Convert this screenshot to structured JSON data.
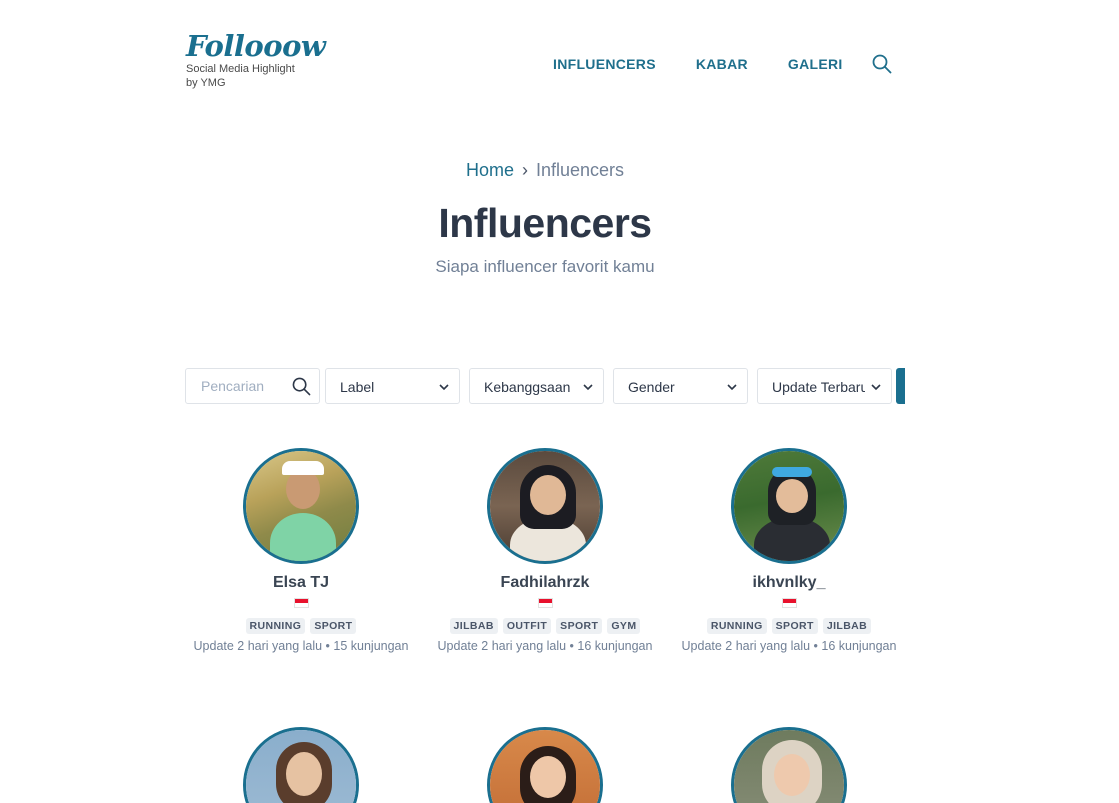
{
  "brand": {
    "name": "Follooow",
    "tagline_line1": "Social Media Highlight",
    "tagline_line2": "by YMG"
  },
  "nav": {
    "items": [
      "INFLUENCERS",
      "KABAR",
      "GALERI"
    ],
    "search_icon": "search-icon"
  },
  "breadcrumb": {
    "home": "Home",
    "separator": "›",
    "current": "Influencers"
  },
  "hero": {
    "title": "Influencers",
    "subtitle": "Siapa influencer favorit kamu"
  },
  "filters": {
    "search_placeholder": "Pencarian",
    "label": "Label",
    "nationality": "Kebanggsaan",
    "gender": "Gender",
    "sort": "Update Terbaru"
  },
  "influencers": [
    {
      "name": "Elsa TJ",
      "tags": [
        "RUNNING",
        "SPORT"
      ],
      "meta": "Update 2 hari yang lalu • 15 kunjungan"
    },
    {
      "name": "Fadhilahrzk",
      "tags": [
        "JILBAB",
        "OUTFIT",
        "SPORT",
        "GYM"
      ],
      "meta": "Update 2 hari yang lalu • 16 kunjungan"
    },
    {
      "name": "ikhvnlky_",
      "tags": [
        "RUNNING",
        "SPORT",
        "JILBAB"
      ],
      "meta": "Update 2 hari yang lalu • 16 kunjungan"
    }
  ],
  "colors": {
    "accent": "#1a6f8f",
    "title": "#2d3748",
    "muted": "#718096"
  }
}
